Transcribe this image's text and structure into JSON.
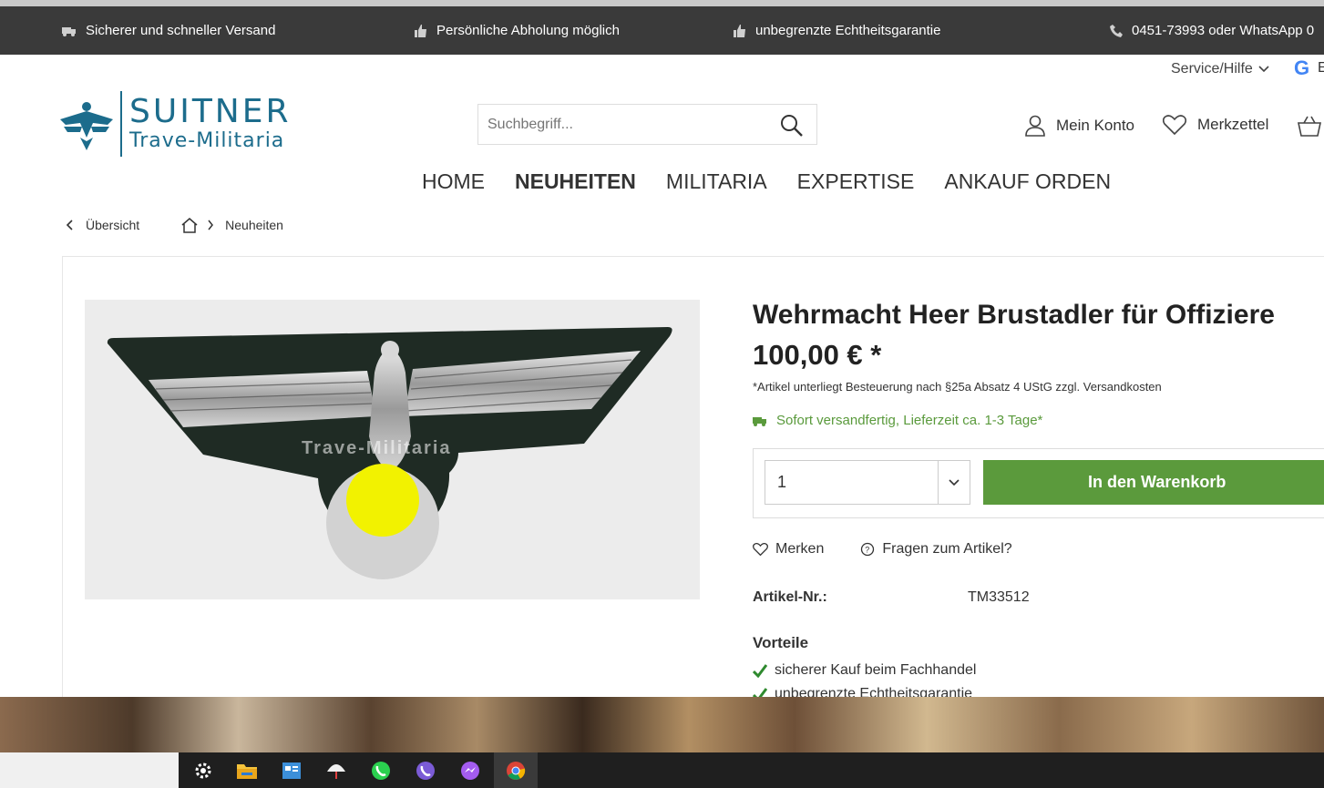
{
  "topbar": {
    "items": [
      {
        "icon": "truck-icon",
        "text": "Sicherer und schneller Versand"
      },
      {
        "icon": "thumbs-up-icon",
        "text": "Persönliche Abholung möglich"
      },
      {
        "icon": "thumbs-up-icon",
        "text": "unbegrenzte Echtheitsgarantie"
      },
      {
        "icon": "phone-icon",
        "text": "0451-73993 oder WhatsApp 0"
      }
    ]
  },
  "header": {
    "service_label": "Service/Hilfe",
    "google_letter": "G",
    "google_cut_text": "E",
    "logo_line1": "SUITNER",
    "logo_line2": "Trave-Militaria",
    "search_placeholder": "Suchbegriff...",
    "account_label": "Mein Konto",
    "wishlist_label": "Merkzettel"
  },
  "nav": {
    "items": [
      "HOME",
      "NEUHEITEN",
      "MILITARIA",
      "EXPERTISE",
      "ANKAUF ORDEN"
    ],
    "active": "NEUHEITEN"
  },
  "breadcrumb": {
    "back_label": "Übersicht",
    "current": "Neuheiten"
  },
  "product": {
    "title": "Wehrmacht Heer Brustadler für Offiziere",
    "price": "100,00 € *",
    "tax_note": "*Artikel unterliegt Besteuerung nach §25a Absatz 4 UStG zzgl. Versandkosten",
    "delivery": "Sofort versandfertig, Lieferzeit ca. 1-3 Tage*",
    "quantity": "1",
    "add_to_cart": "In den Warenkorb",
    "remember_label": "Merken",
    "question_label": "Fragen zum Artikel?",
    "article_nr_label": "Artikel-Nr.:",
    "article_nr": "TM33512",
    "image_watermark": "Trave-Militaria",
    "advantages_title": "Vorteile",
    "advantages": [
      "sicherer Kauf beim Fachhandel",
      "unbegrenzte Echtheitsgarantie"
    ]
  },
  "colors": {
    "topbar_bg": "#3a3a3a",
    "brand_blue": "#1c6c8c",
    "accent_green": "#5b9a3c",
    "delivery_green": "#5a9a3c"
  },
  "taskbar": {
    "icons": [
      "settings-icon",
      "file-explorer-icon",
      "app-window-icon",
      "umbrella-icon",
      "whatsapp-icon",
      "viber-icon",
      "messenger-icon",
      "chrome-icon"
    ]
  }
}
